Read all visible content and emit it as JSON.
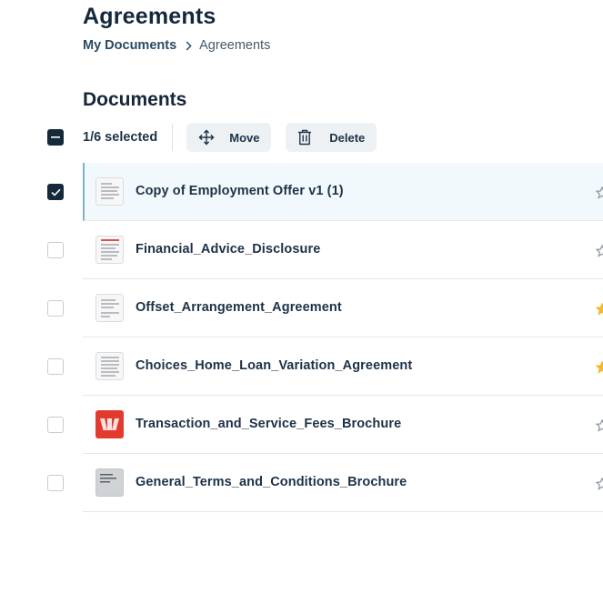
{
  "header": {
    "title": "Agreements",
    "breadcrumb": {
      "parent": "My Documents",
      "current": "Agreements"
    }
  },
  "documents": {
    "section_title": "Documents",
    "selection_text": "1/6 selected",
    "actions": {
      "move_label": "Move",
      "delete_label": "Delete"
    },
    "items": [
      {
        "name": "Copy of Employment Offer v1 (1)",
        "selected": true,
        "starred": false
      },
      {
        "name": "Financial_Advice_Disclosure",
        "selected": false,
        "starred": false
      },
      {
        "name": "Offset_Arrangement_Agreement",
        "selected": false,
        "starred": true
      },
      {
        "name": "Choices_Home_Loan_Variation_Agreement",
        "selected": false,
        "starred": true
      },
      {
        "name": "Transaction_and_Service_Fees_Brochure",
        "selected": false,
        "starred": false
      },
      {
        "name": "General_Terms_and_Conditions_Brochure",
        "selected": false,
        "starred": false
      }
    ]
  },
  "colors": {
    "star_filled": "#f5b82e",
    "star_empty": "#8a96a2",
    "accent": "#16293b"
  }
}
